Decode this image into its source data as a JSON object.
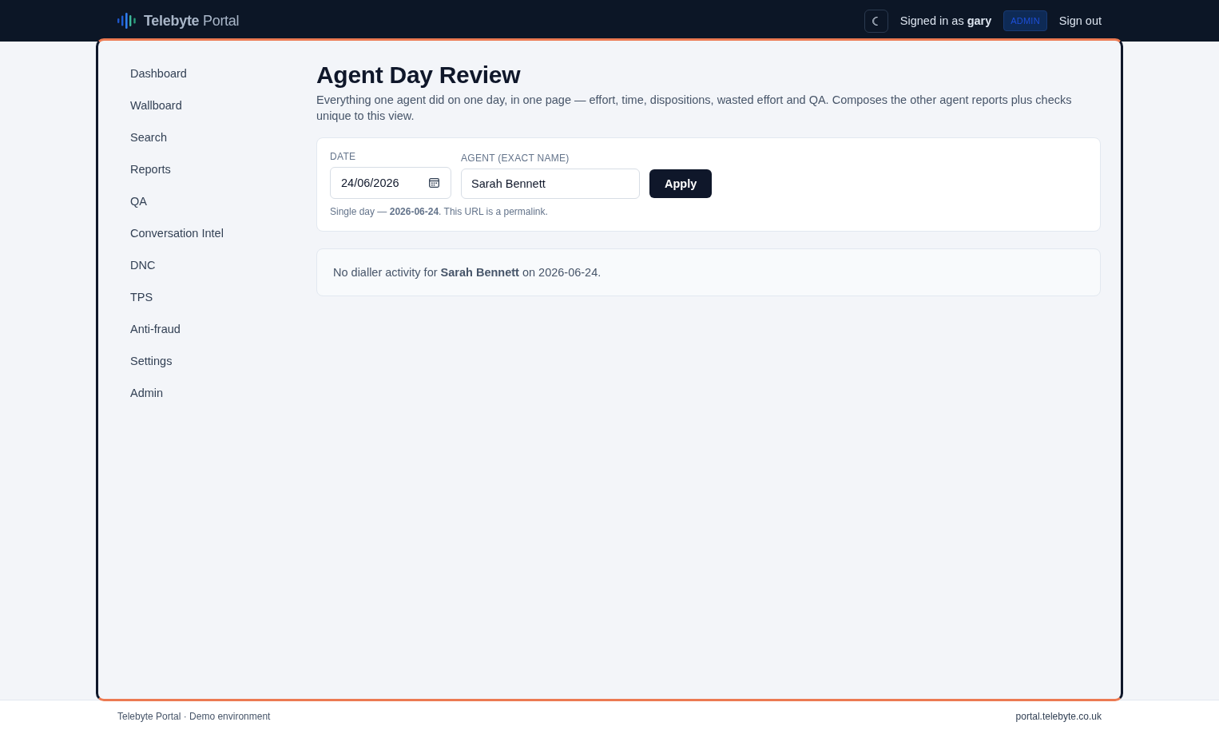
{
  "header": {
    "brand": "**Telebyte** Portal",
    "user": "Signed in as **gary**",
    "role_badge": "ADMIN",
    "sign_out": "Sign out"
  },
  "sidebar": {
    "items": [
      {
        "label": "Dashboard",
        "selected": false
      },
      {
        "label": "Wallboard",
        "selected": false
      },
      {
        "label": "Search",
        "selected": false
      },
      {
        "label": "Reports",
        "selected": false
      },
      {
        "label": "QA",
        "selected": false
      },
      {
        "label": "Conversation Intel",
        "selected": false
      },
      {
        "label": "DNC",
        "selected": false
      },
      {
        "label": "TPS",
        "selected": false
      },
      {
        "label": "Anti-fraud",
        "selected": false
      },
      {
        "label": "Settings",
        "selected": false
      },
      {
        "label": "Admin",
        "selected": false
      }
    ]
  },
  "page": {
    "title": "Agent Day Review",
    "description": "Everything one agent did on one day, in one page — effort, time, dispositions, wasted effort and QA. Composes the other agent reports plus checks unique to this view."
  },
  "filters": {
    "fields": [
      {
        "kind": "date",
        "label": "DATE",
        "value": "24/06/2026"
      },
      {
        "kind": "text",
        "label": "AGENT (EXACT NAME)",
        "value": "Sarah Bennett"
      }
    ],
    "apply_button": "Apply",
    "hint": "Single day — **2026-06-24**. This URL is a permalink."
  },
  "result": {
    "message": "No dialler activity for **Sarah Bennett** on 2026-06-24."
  },
  "footer": {
    "left": "Telebyte Portal · Demo environment",
    "right": "portal.telebyte.co.uk"
  }
}
